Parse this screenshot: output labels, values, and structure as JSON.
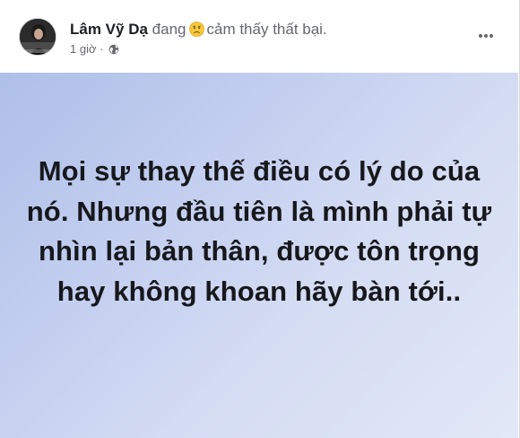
{
  "post": {
    "author": "Lâm Vỹ Dạ",
    "activity_prefix": "đang",
    "activity_emoji": "sad-face-emoji",
    "activity_text": "cảm thấy thất bại.",
    "timestamp": "1 giờ",
    "privacy_icon": "globe-icon",
    "more_icon": "more-options-icon",
    "text": "Mọi sự thay thế điều có lý do của nó. Nhưng đầu tiên là mình phải tự nhìn lại bản thân, được tôn trọng hay không khoan hãy bàn tới..",
    "background_gradient": [
      "#aebfe8",
      "#e2e8f7"
    ]
  }
}
